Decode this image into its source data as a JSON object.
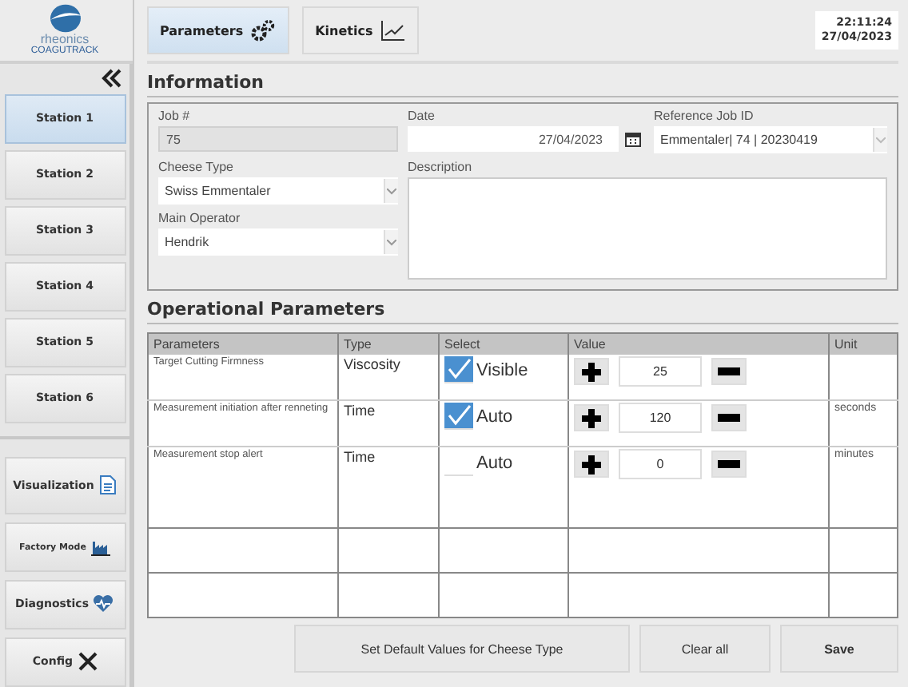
{
  "sidebar": {
    "logo": {
      "line1": "rheonics",
      "line2": "COAGUTRACK"
    },
    "stations": [
      {
        "label": "Station 1",
        "selected": true
      },
      {
        "label": "Station 2",
        "selected": false
      },
      {
        "label": "Station 3",
        "selected": false
      },
      {
        "label": "Station 4",
        "selected": false
      },
      {
        "label": "Station 5",
        "selected": false
      },
      {
        "label": "Station 6",
        "selected": false
      }
    ],
    "tools": [
      {
        "label": "Visualization",
        "kind": "document"
      },
      {
        "label": "Factory Mode",
        "kind": "factory"
      },
      {
        "label": "Diagnostics",
        "kind": "heart"
      },
      {
        "label": "Config",
        "kind": "tools"
      }
    ]
  },
  "tabs": [
    {
      "label": "Parameters",
      "selected": true,
      "kind": "gears"
    },
    {
      "label": "Kinetics",
      "selected": false,
      "kind": "chart"
    }
  ],
  "clock": {
    "time": "22:11:24",
    "date": "27/04/2023"
  },
  "information": {
    "heading": "Information",
    "job": {
      "label": "Job #",
      "value": "75"
    },
    "date": {
      "label": "Date",
      "value": "27/04/2023"
    },
    "reference": {
      "label": "Reference Job ID",
      "value": "Emmentaler| 74 | 20230419"
    },
    "cheese_type": {
      "label": "Cheese Type",
      "value": "Swiss Emmentaler"
    },
    "description": {
      "label": "Description"
    },
    "operator": {
      "label": "Main Operator",
      "value": "Hendrik"
    }
  },
  "operational": {
    "heading": "Operational Parameters",
    "columns": [
      "Parameters",
      "Type",
      "Select",
      "Value",
      "Unit"
    ],
    "rows": [
      {
        "name": "Target Cutting Firmness",
        "type": "Viscosity",
        "select_label": "Visible",
        "checked": true,
        "value": "25"
      },
      {
        "name": "Measurement initiation after renneting",
        "type": "Time",
        "select_label": "Auto",
        "checked": true,
        "value": "120",
        "unit": "seconds"
      },
      {
        "name": "Measurement stop alert",
        "type": "Time",
        "select_label": "Auto",
        "checked": false,
        "value": "0",
        "unit": "minutes"
      }
    ]
  },
  "buttons": [
    {
      "label": "Set Default Values for Cheese Type",
      "kind": "normal"
    },
    {
      "label": "Clear all",
      "kind": "normal"
    },
    {
      "label": "Save",
      "kind": "primary"
    }
  ]
}
